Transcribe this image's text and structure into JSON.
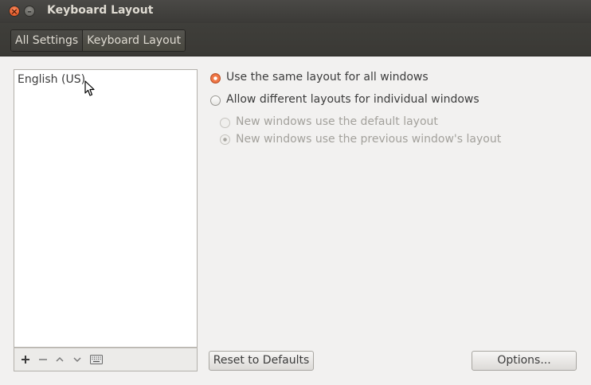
{
  "window": {
    "title": "Keyboard Layout"
  },
  "toolbar": {
    "breadcrumbs": [
      {
        "label": "All Settings"
      },
      {
        "label": "Keyboard Layout"
      }
    ]
  },
  "layouts": {
    "items": [
      {
        "label": "English (US)"
      }
    ]
  },
  "options": {
    "same_layout": {
      "label": "Use the same layout for all windows",
      "selected": true
    },
    "different_layouts": {
      "label": "Allow different layouts for individual windows",
      "selected": false
    },
    "default_layout": {
      "label": "New windows use the default layout",
      "selected": false,
      "enabled": false
    },
    "previous_layout": {
      "label": "New windows use the previous window's layout",
      "selected": true,
      "enabled": false
    }
  },
  "buttons": {
    "reset": "Reset to Defaults",
    "options": "Options..."
  },
  "colors": {
    "accent": "#f07746",
    "titlebar": "#3c3b37"
  },
  "icons": [
    "close-icon",
    "minimize-icon",
    "plus-icon",
    "minus-icon",
    "arrow-up-icon",
    "arrow-down-icon",
    "keyboard-icon"
  ]
}
